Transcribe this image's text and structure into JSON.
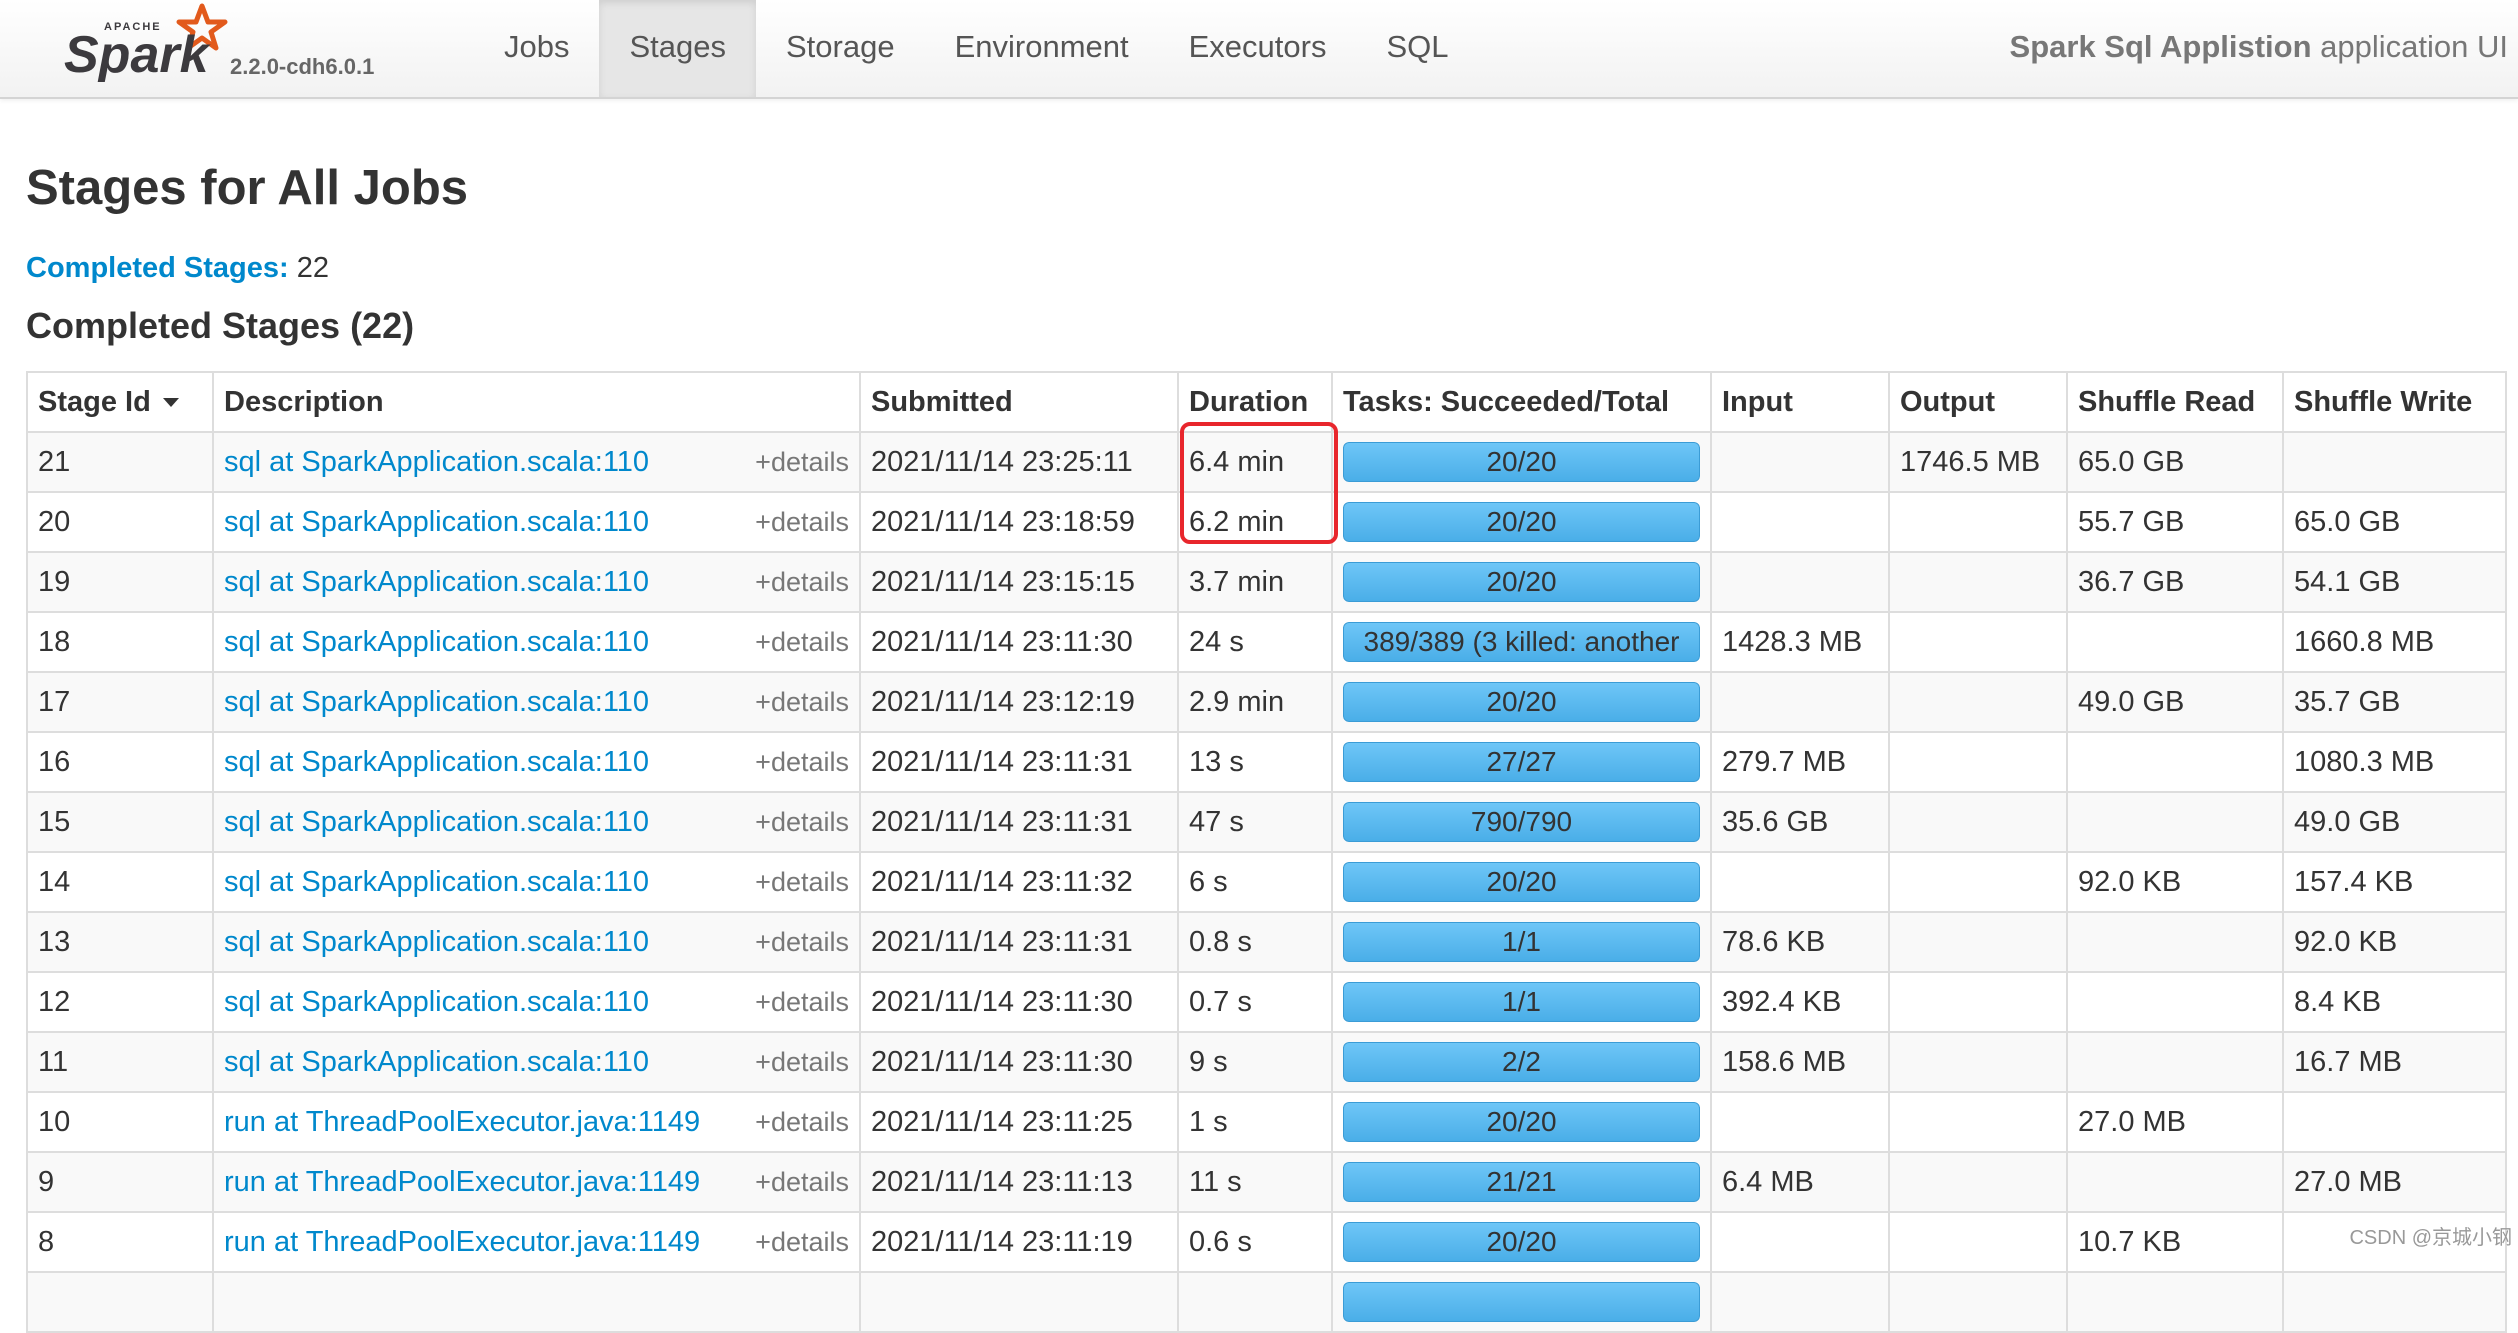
{
  "brand": {
    "apache_text": "APACHE",
    "spark_text": "Spark",
    "version": "2.2.0-cdh6.0.1",
    "colors": {
      "star": "#e25a1c",
      "text": "#3c3a3e"
    }
  },
  "nav": {
    "tabs": [
      {
        "label": "Jobs"
      },
      {
        "label": "Stages"
      },
      {
        "label": "Storage"
      },
      {
        "label": "Environment"
      },
      {
        "label": "Executors"
      },
      {
        "label": "SQL"
      }
    ],
    "active_tab": "Stages"
  },
  "app_title": {
    "name": "Spark Sql Applistion",
    "suffix": "application UI"
  },
  "page": {
    "title": "Stages for All Jobs",
    "summary_label": "Completed Stages:",
    "summary_count": "22",
    "section_title": "Completed Stages (22)"
  },
  "table": {
    "headers": [
      "Stage Id",
      "Description",
      "Submitted",
      "Duration",
      "Tasks: Succeeded/Total",
      "Input",
      "Output",
      "Shuffle Read",
      "Shuffle Write"
    ],
    "details_label": "+details",
    "rows": [
      {
        "id": "21",
        "desc": "sql at SparkApplication.scala:110",
        "submitted": "2021/11/14 23:25:11",
        "duration": "6.4 min",
        "tasks": "20/20",
        "progress": 1.0,
        "input": "",
        "output": "1746.5 MB",
        "shuffle_read": "65.0 GB",
        "shuffle_write": ""
      },
      {
        "id": "20",
        "desc": "sql at SparkApplication.scala:110",
        "submitted": "2021/11/14 23:18:59",
        "duration": "6.2 min",
        "tasks": "20/20",
        "progress": 1.0,
        "input": "",
        "output": "",
        "shuffle_read": "55.7 GB",
        "shuffle_write": "65.0 GB"
      },
      {
        "id": "19",
        "desc": "sql at SparkApplication.scala:110",
        "submitted": "2021/11/14 23:15:15",
        "duration": "3.7 min",
        "tasks": "20/20",
        "progress": 1.0,
        "input": "",
        "output": "",
        "shuffle_read": "36.7 GB",
        "shuffle_write": "54.1 GB"
      },
      {
        "id": "18",
        "desc": "sql at SparkApplication.scala:110",
        "submitted": "2021/11/14 23:11:30",
        "duration": "24 s",
        "tasks": "389/389 (3 killed: another",
        "progress": 1.0,
        "input": "1428.3 MB",
        "output": "",
        "shuffle_read": "",
        "shuffle_write": "1660.8 MB"
      },
      {
        "id": "17",
        "desc": "sql at SparkApplication.scala:110",
        "submitted": "2021/11/14 23:12:19",
        "duration": "2.9 min",
        "tasks": "20/20",
        "progress": 1.0,
        "input": "",
        "output": "",
        "shuffle_read": "49.0 GB",
        "shuffle_write": "35.7 GB"
      },
      {
        "id": "16",
        "desc": "sql at SparkApplication.scala:110",
        "submitted": "2021/11/14 23:11:31",
        "duration": "13 s",
        "tasks": "27/27",
        "progress": 1.0,
        "input": "279.7 MB",
        "output": "",
        "shuffle_read": "",
        "shuffle_write": "1080.3 MB"
      },
      {
        "id": "15",
        "desc": "sql at SparkApplication.scala:110",
        "submitted": "2021/11/14 23:11:31",
        "duration": "47 s",
        "tasks": "790/790",
        "progress": 1.0,
        "input": "35.6 GB",
        "output": "",
        "shuffle_read": "",
        "shuffle_write": "49.0 GB"
      },
      {
        "id": "14",
        "desc": "sql at SparkApplication.scala:110",
        "submitted": "2021/11/14 23:11:32",
        "duration": "6 s",
        "tasks": "20/20",
        "progress": 1.0,
        "input": "",
        "output": "",
        "shuffle_read": "92.0 KB",
        "shuffle_write": "157.4 KB"
      },
      {
        "id": "13",
        "desc": "sql at SparkApplication.scala:110",
        "submitted": "2021/11/14 23:11:31",
        "duration": "0.8 s",
        "tasks": "1/1",
        "progress": 1.0,
        "input": "78.6 KB",
        "output": "",
        "shuffle_read": "",
        "shuffle_write": "92.0 KB"
      },
      {
        "id": "12",
        "desc": "sql at SparkApplication.scala:110",
        "submitted": "2021/11/14 23:11:30",
        "duration": "0.7 s",
        "tasks": "1/1",
        "progress": 1.0,
        "input": "392.4 KB",
        "output": "",
        "shuffle_read": "",
        "shuffle_write": "8.4 KB"
      },
      {
        "id": "11",
        "desc": "sql at SparkApplication.scala:110",
        "submitted": "2021/11/14 23:11:30",
        "duration": "9 s",
        "tasks": "2/2",
        "progress": 1.0,
        "input": "158.6 MB",
        "output": "",
        "shuffle_read": "",
        "shuffle_write": "16.7 MB"
      },
      {
        "id": "10",
        "desc": "run at ThreadPoolExecutor.java:1149",
        "submitted": "2021/11/14 23:11:25",
        "duration": "1 s",
        "tasks": "20/20",
        "progress": 1.0,
        "input": "",
        "output": "",
        "shuffle_read": "27.0 MB",
        "shuffle_write": ""
      },
      {
        "id": "9",
        "desc": "run at ThreadPoolExecutor.java:1149",
        "submitted": "2021/11/14 23:11:13",
        "duration": "11 s",
        "tasks": "21/21",
        "progress": 1.0,
        "input": "6.4 MB",
        "output": "",
        "shuffle_read": "",
        "shuffle_write": "27.0 MB"
      },
      {
        "id": "8",
        "desc": "run at ThreadPoolExecutor.java:1149",
        "submitted": "2021/11/14 23:11:19",
        "duration": "0.6 s",
        "tasks": "20/20",
        "progress": 1.0,
        "input": "",
        "output": "",
        "shuffle_read": "10.7 KB",
        "shuffle_write": ""
      },
      {
        "id": "",
        "desc": "",
        "submitted": "",
        "duration": "",
        "tasks": "",
        "progress": 1.0,
        "input": "",
        "output": "",
        "shuffle_read": "",
        "shuffle_write": ""
      }
    ]
  },
  "watermark": "CSDN @京城小钢",
  "colors": {
    "link": "#0088cc",
    "progress_bar": "#5bb7ee",
    "highlight": "#e8262c"
  }
}
